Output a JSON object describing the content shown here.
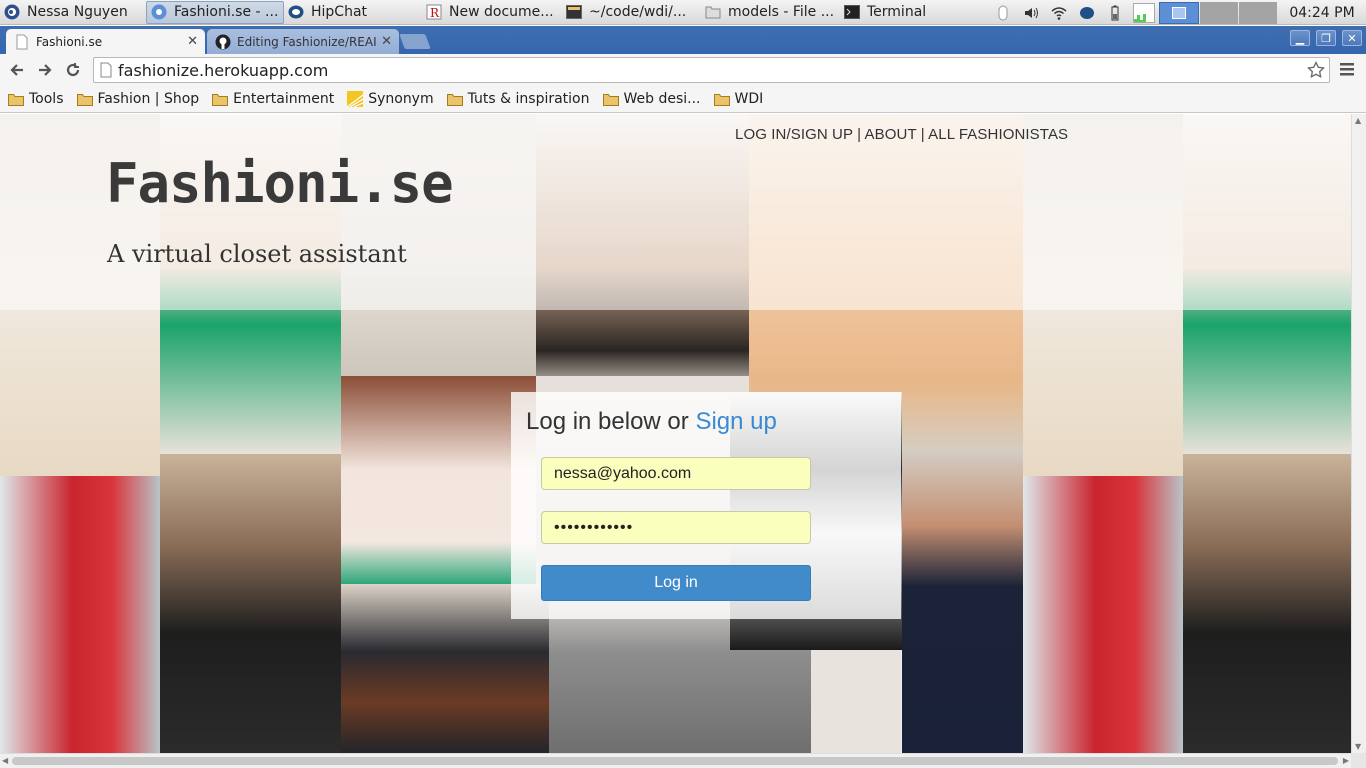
{
  "taskbar": {
    "items": [
      {
        "label": "Nessa Nguyen",
        "icon": "pidgin-icon"
      },
      {
        "label": "Fashioni.se - ...",
        "icon": "chrome-icon",
        "active": true
      },
      {
        "label": "HipChat",
        "icon": "hipchat-icon"
      },
      {
        "label": "New docume...",
        "icon": "document-icon"
      },
      {
        "label": "~/code/wdi/...",
        "icon": "terminal-icon"
      },
      {
        "label": "models - File ...",
        "icon": "folder-icon"
      },
      {
        "label": "Terminal",
        "icon": "terminal-icon"
      }
    ],
    "clock": "04:24 PM"
  },
  "browser": {
    "tabs": [
      {
        "label": "Fashioni.se",
        "active": true
      },
      {
        "label": "Editing Fashionize/REAI",
        "active": false
      }
    ],
    "url": "fashionize.herokuapp.com",
    "bookmarks": [
      {
        "label": "Tools",
        "icon": "folder-icon"
      },
      {
        "label": "Fashion | Shop",
        "icon": "folder-icon"
      },
      {
        "label": "Entertainment",
        "icon": "folder-icon"
      },
      {
        "label": "Synonym",
        "icon": "synonym-icon"
      },
      {
        "label": "Tuts & inspiration",
        "icon": "folder-icon"
      },
      {
        "label": "Web desi...",
        "icon": "folder-icon"
      },
      {
        "label": "WDI",
        "icon": "folder-icon"
      }
    ]
  },
  "page": {
    "nav": {
      "login_signup": "LOG IN/SIGN UP",
      "sep1": " | ",
      "about": "ABOUT",
      "sep2": " | ",
      "all_fashionistas": "ALL FASHIONISTAS"
    },
    "title": "Fashioni.se",
    "tagline": "A virtual closet assistant",
    "login": {
      "heading": "Log in below or ",
      "signup_link": "Sign up",
      "email_value": "nessa@yahoo.com",
      "password_value": "••••••••••••",
      "button_label": "Log in"
    }
  },
  "colors": {
    "chrome_frame": "#3566ae",
    "login_button": "#428bca",
    "signup_link": "#3a8ad3",
    "autofill_field": "#faffbd"
  }
}
